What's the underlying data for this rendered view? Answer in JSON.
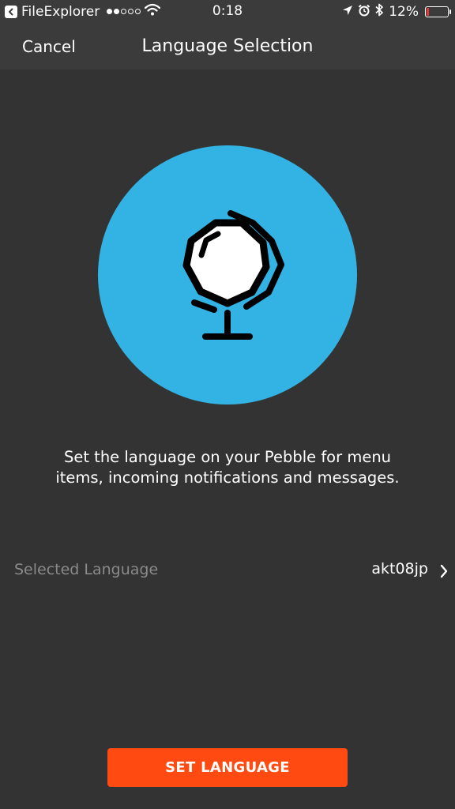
{
  "status_bar": {
    "back_app": "FileExplorer",
    "time": "0:18",
    "battery_percent": "12%",
    "battery_level": 0.12,
    "signal_dots_filled": 2,
    "signal_dots_total": 5,
    "icons": [
      "back-arrow-icon",
      "wifi-icon",
      "location-arrow-icon",
      "alarm-clock-icon",
      "bluetooth-icon",
      "battery-icon"
    ]
  },
  "nav": {
    "cancel_label": "Cancel",
    "title": "Language Selection"
  },
  "hero": {
    "icon": "globe-icon",
    "circle_color": "#33b3e3"
  },
  "description": "Set the language on your Pebble for menu items, incoming notifications and messages.",
  "language_row": {
    "label": "Selected Language",
    "value": "akt08jp",
    "icon": "chevron-right-icon"
  },
  "primary_button": {
    "label": "SET LANGUAGE",
    "color": "#ff4a11"
  }
}
